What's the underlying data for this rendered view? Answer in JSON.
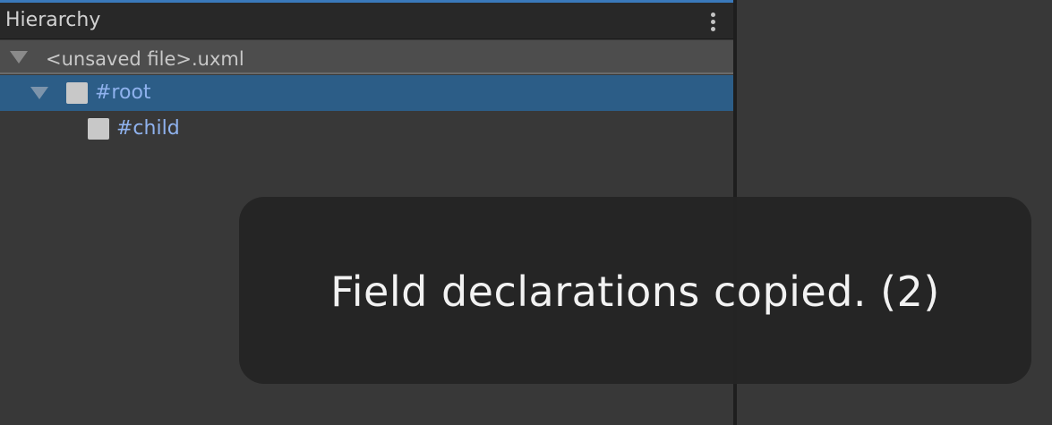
{
  "panel": {
    "title": "Hierarchy",
    "menu_icon": "vertical-ellipsis-icon"
  },
  "tree": {
    "file": {
      "label": "<unsaved file>.uxml",
      "expanded": true,
      "icon": "triangle-down-icon"
    },
    "items": [
      {
        "label": "#root",
        "selected": true,
        "expanded": true,
        "icon": "element-square-icon"
      },
      {
        "label": "#child",
        "selected": false,
        "icon": "element-square-icon"
      }
    ]
  },
  "toast": {
    "message": "Field declarations copied. (2)"
  },
  "colors": {
    "accent": "#3a79bb",
    "selection": "#2c5d87",
    "element_name": "#8fb2ee"
  }
}
